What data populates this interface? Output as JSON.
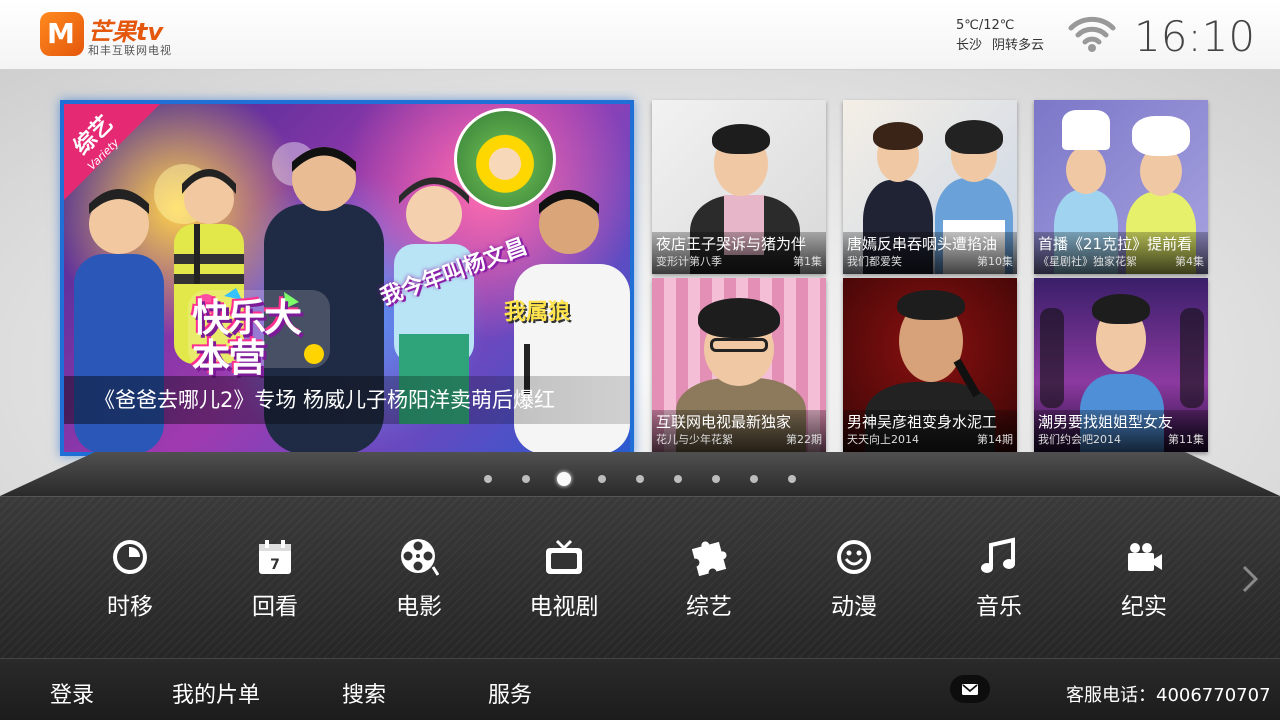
{
  "header": {
    "logo_mark": "M",
    "logo_name": "芒果tv",
    "logo_sub": "和丰互联网电视",
    "weather": {
      "temp": "5℃/12℃",
      "city": "长沙",
      "condition": "阴转多云"
    },
    "wifi_icon": "wifi-icon",
    "time": "16:10"
  },
  "featured": {
    "badge": "综艺",
    "badge_sub": "Variety",
    "show_logo_text": "快乐大本营",
    "quote1": "我今年叫杨文昌",
    "quote2": "我属狼",
    "caption": "《爸爸去哪儿2》专场 杨威儿子杨阳洋卖萌后爆红"
  },
  "tiles": [
    {
      "title": "夜店王子哭诉与猪为伴",
      "series": "变形计第八季",
      "episode": "第1集"
    },
    {
      "title": "唐嫣反串吞咽头遭掐油",
      "series": "我们都爱笑",
      "episode": "第10集"
    },
    {
      "title": "首播《21克拉》提前看",
      "series": "《星剧社》独家花絮",
      "episode": "第4集"
    },
    {
      "title": "互联网电视最新独家",
      "series": "花儿与少年花絮",
      "episode": "第22期"
    },
    {
      "title": "男神吴彦祖变身水泥工",
      "series": "天天向上2014",
      "episode": "第14期"
    },
    {
      "title": "潮男要找姐姐型女友",
      "series": "我们约会吧2014",
      "episode": "第11集"
    }
  ],
  "pager": {
    "count": 9,
    "active": 3
  },
  "categories": [
    {
      "label": "时移",
      "icon": "clock-icon"
    },
    {
      "label": "回看",
      "icon": "calendar-icon",
      "day": "7"
    },
    {
      "label": "电影",
      "icon": "film-reel-icon"
    },
    {
      "label": "电视剧",
      "icon": "tv-icon"
    },
    {
      "label": "综艺",
      "icon": "puzzle-icon"
    },
    {
      "label": "动漫",
      "icon": "smiley-icon"
    },
    {
      "label": "音乐",
      "icon": "music-note-icon"
    },
    {
      "label": "纪实",
      "icon": "video-camera-icon"
    }
  ],
  "footer": {
    "login": "登录",
    "my_list": "我的片单",
    "search": "搜索",
    "service": "服务",
    "mail_icon": "mail-icon",
    "hotline": "客服电话：4006770707"
  },
  "colors": {
    "brand": "#e4570c",
    "focus": "#1f6fd6",
    "badge": "#e52a73"
  }
}
